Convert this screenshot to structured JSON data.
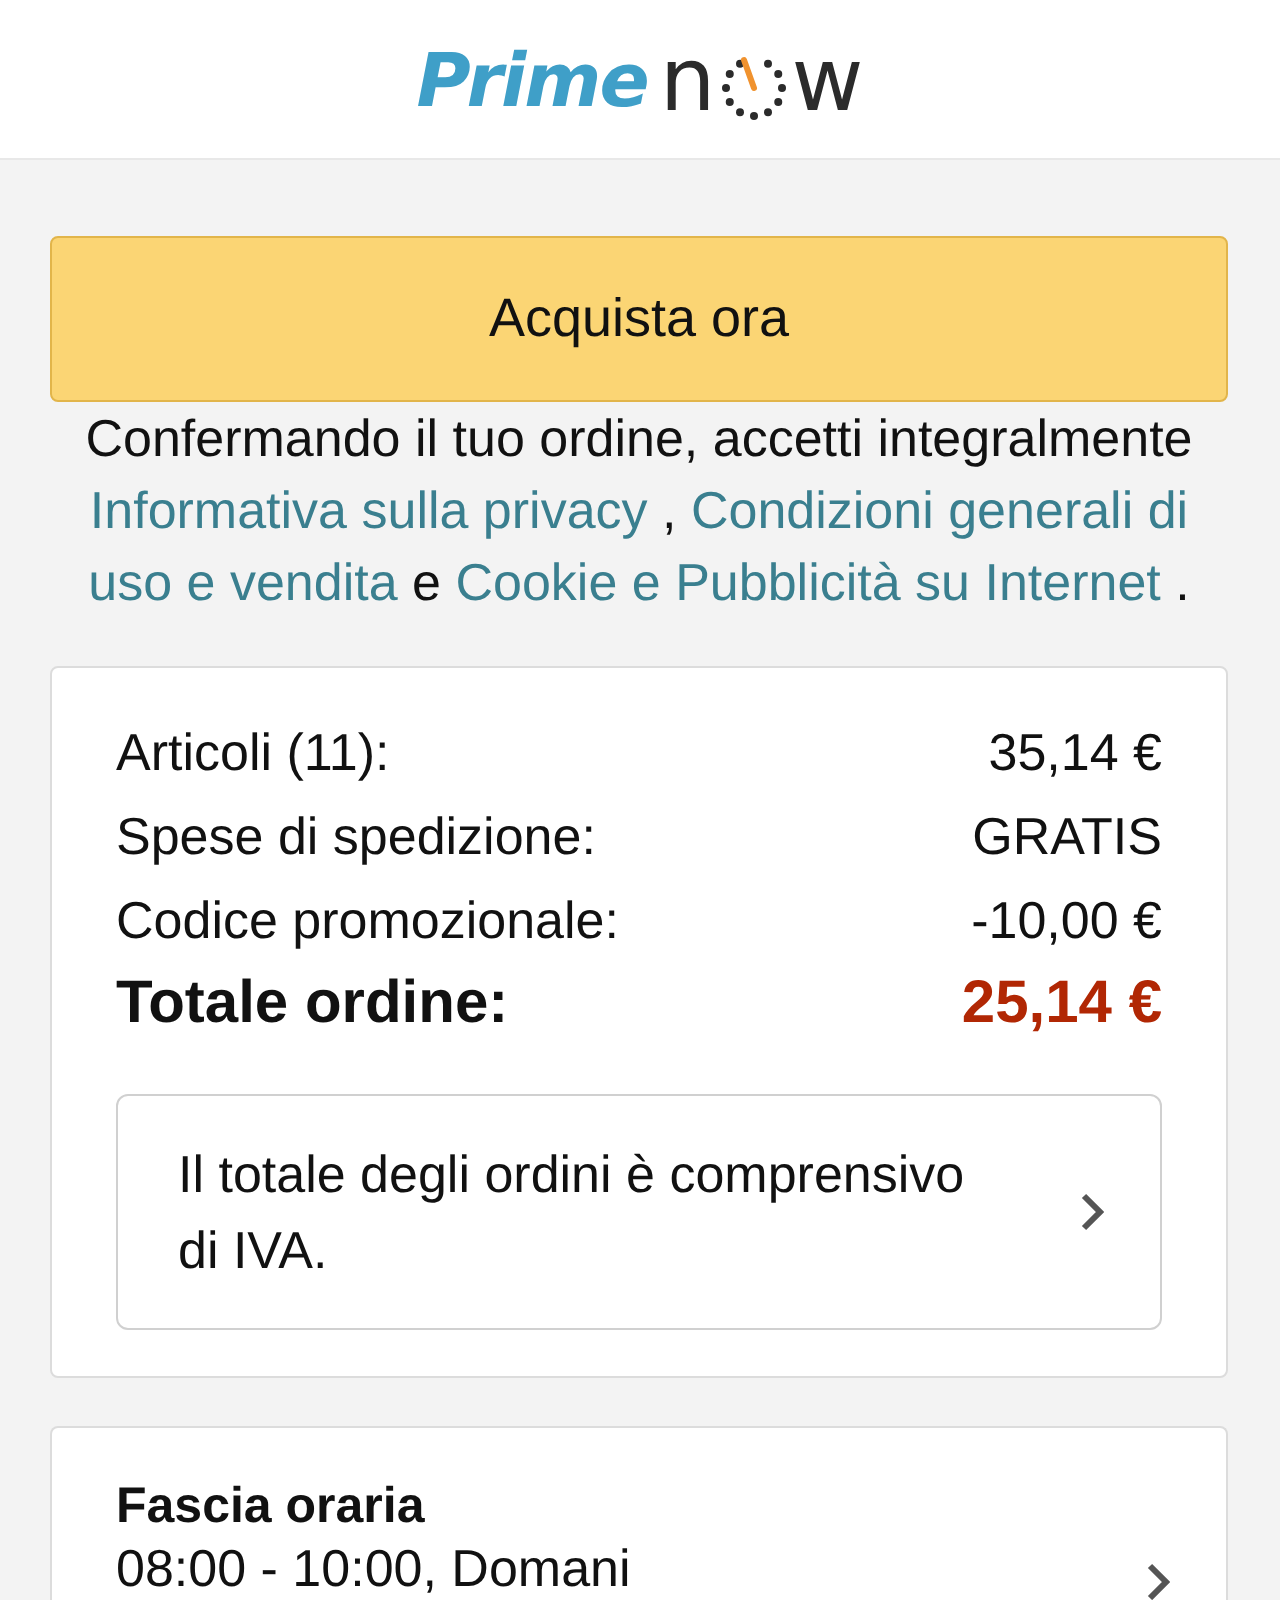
{
  "header": {
    "logo": {
      "brand": "Prime",
      "word_start": "n",
      "word_end": "w"
    }
  },
  "buy_button": {
    "label": "Acquista ora"
  },
  "terms": {
    "lines": [
      [
        {
          "kind": "text",
          "text": "Confermando il tuo ordine, accetti integralmente"
        }
      ],
      [
        {
          "kind": "link",
          "text": "Informativa sulla privacy"
        },
        {
          "kind": "text",
          "text": " , "
        },
        {
          "kind": "link",
          "text": "Condizioni generali di"
        }
      ],
      [
        {
          "kind": "link",
          "text": "uso e vendita"
        },
        {
          "kind": "text",
          "text": " e "
        },
        {
          "kind": "link",
          "text": "Cookie e Pubblicità su Internet"
        },
        {
          "kind": "text",
          "text": " ."
        }
      ]
    ]
  },
  "summary": {
    "rows": [
      {
        "kind": "item",
        "label": "Articoli (11):",
        "value": "35,14 €"
      },
      {
        "kind": "item",
        "label": "Spese di spedizione:",
        "value": "GRATIS"
      },
      {
        "kind": "item",
        "label": "Codice promozionale:",
        "value": "-10,00 €"
      },
      {
        "kind": "total",
        "label": "Totale ordine:",
        "value": "25,14 €"
      }
    ],
    "notice": {
      "text": "Il totale degli ordini è comprensivo di IVA."
    }
  },
  "delivery": {
    "title": "Fascia oraria",
    "value": "08:00 - 10:00, Domani"
  }
}
